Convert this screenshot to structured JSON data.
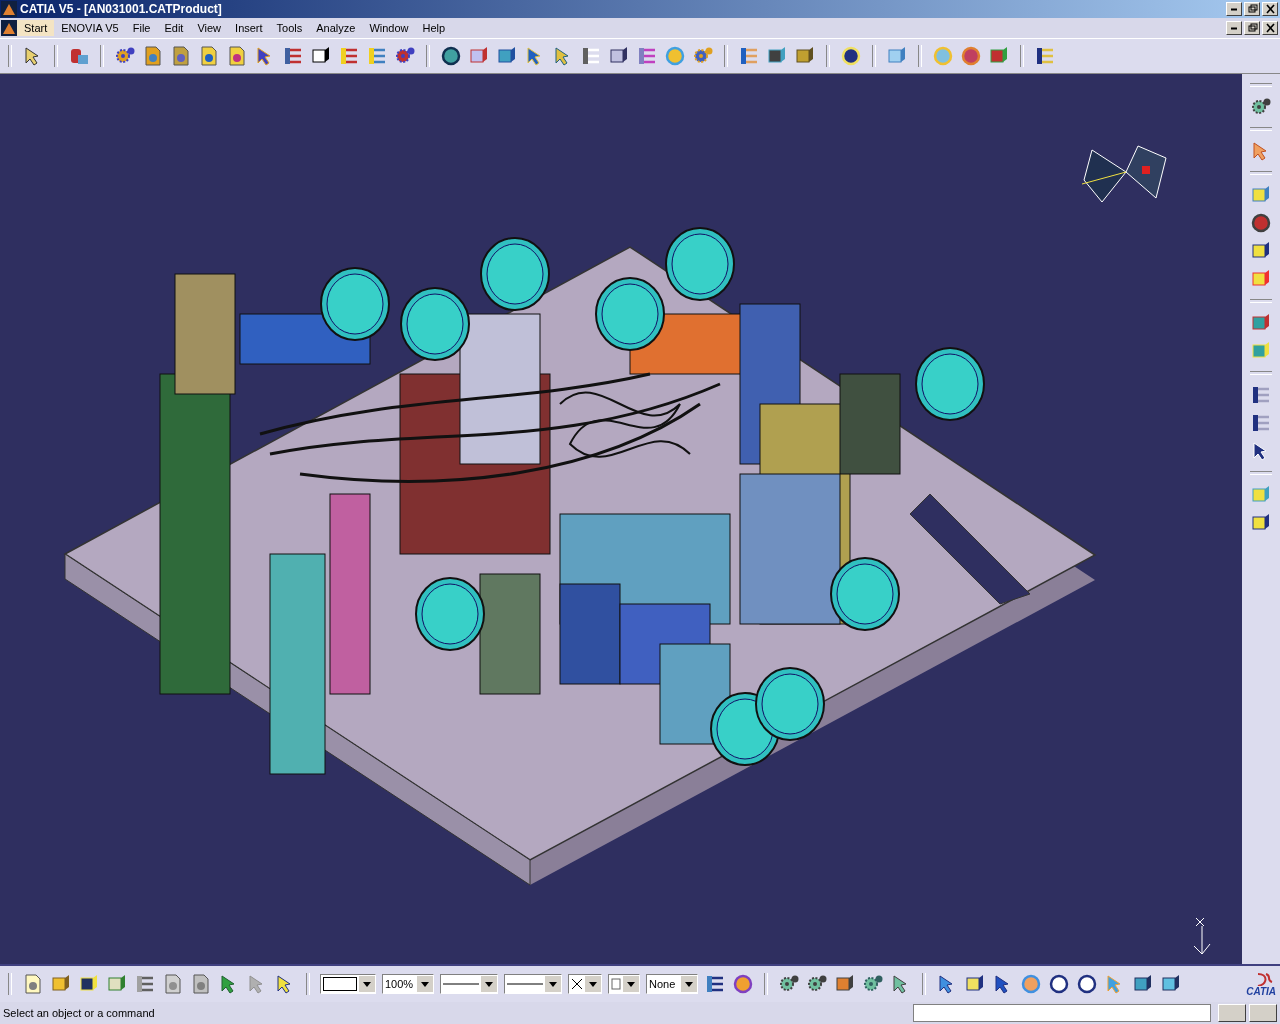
{
  "window": {
    "title": "CATIA V5 - [AN031001.CATProduct]"
  },
  "menu": [
    {
      "label": "Start",
      "selected": true
    },
    {
      "label": "ENOVIA V5",
      "selected": false
    },
    {
      "label": "File",
      "selected": false
    },
    {
      "label": "Edit",
      "selected": false
    },
    {
      "label": "View",
      "selected": false
    },
    {
      "label": "Insert",
      "selected": false
    },
    {
      "label": "Tools",
      "selected": false
    },
    {
      "label": "Analyze",
      "selected": false
    },
    {
      "label": "Window",
      "selected": false
    },
    {
      "label": "Help",
      "selected": false
    }
  ],
  "bottom_toolbar": {
    "zoom_dropdown": {
      "value": "100%"
    },
    "layer_dropdown": {
      "value": "None"
    }
  },
  "logo": {
    "text": "CATIA"
  },
  "status_bar": {
    "message": "Select an object or a command"
  }
}
